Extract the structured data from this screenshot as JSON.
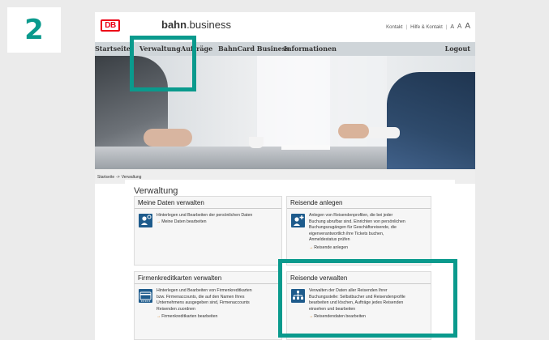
{
  "step": {
    "number": "2"
  },
  "header": {
    "logo_text": "DB",
    "brand_bold": "bahn",
    "brand_rest": ".business",
    "links": [
      "Kontakt",
      "Hilfe & Kontakt",
      "A",
      "A",
      "A"
    ],
    "separators": [
      "|",
      "|"
    ]
  },
  "nav": {
    "items": [
      "Startseite",
      "Verwaltung",
      "Aufträge",
      "BahnCard Business",
      "Informationen"
    ],
    "logout": "Logout"
  },
  "breadcrumb": {
    "items": [
      "Startseite",
      "->",
      "Verwaltung"
    ]
  },
  "page": {
    "title": "Verwaltung"
  },
  "cards": [
    {
      "title": "Meine Daten verwalten",
      "icon": "user-settings-icon",
      "desc": [
        "Hinterlegen und Bearbeiten der persönlichen Daten"
      ],
      "link_arrow": "→",
      "link": "Meine Daten bearbeiten"
    },
    {
      "title": "Reisende anlegen",
      "icon": "add-user-icon",
      "desc": [
        "Anlegen von Reisendenprofilen, die bei jeder",
        "Buchung abrufbar sind. Einrichten von persönlichen",
        "Buchungszugängen für Geschäftsreisende, die",
        "eigenverantwortlich ihre Tickets buchen,",
        "Anmeldestatus prüfen"
      ],
      "link_arrow": "→",
      "link": "Reisende anlegen"
    },
    {
      "title": "Firmenkreditkarten verwalten",
      "icon": "credit-card-icon",
      "desc": [
        "Hinterlegen und Bearbeiten von Firmenkreditkarten",
        "bzw. Firmenaccounts, die auf den Namen Ihres",
        "Unternehmens ausgegeben sind, Firmenaccounts",
        "Reisenden zuordnen"
      ],
      "link_arrow": "→",
      "link": "Firmenkreditkarten bearbeiten"
    },
    {
      "title": "Reisende verwalten",
      "icon": "org-chart-icon",
      "desc": [
        "Verwalten der Daten aller Reisenden Ihrer",
        "Buchungsstelle: Selbstbucher und Reisendenprofile",
        "bearbeiten und löschen, Aufträge jedes Reisenden",
        "einsehen und bearbeiten"
      ],
      "link_arrow": "→",
      "link": "Reisendendaten bearbeiten"
    }
  ],
  "colors": {
    "accent": "#0a9a8d",
    "db_red": "#ec0016",
    "nav_bg": "#cfd5d9",
    "icon_blue": "#1e5b8c",
    "link_arrow": "#d27a1a"
  }
}
